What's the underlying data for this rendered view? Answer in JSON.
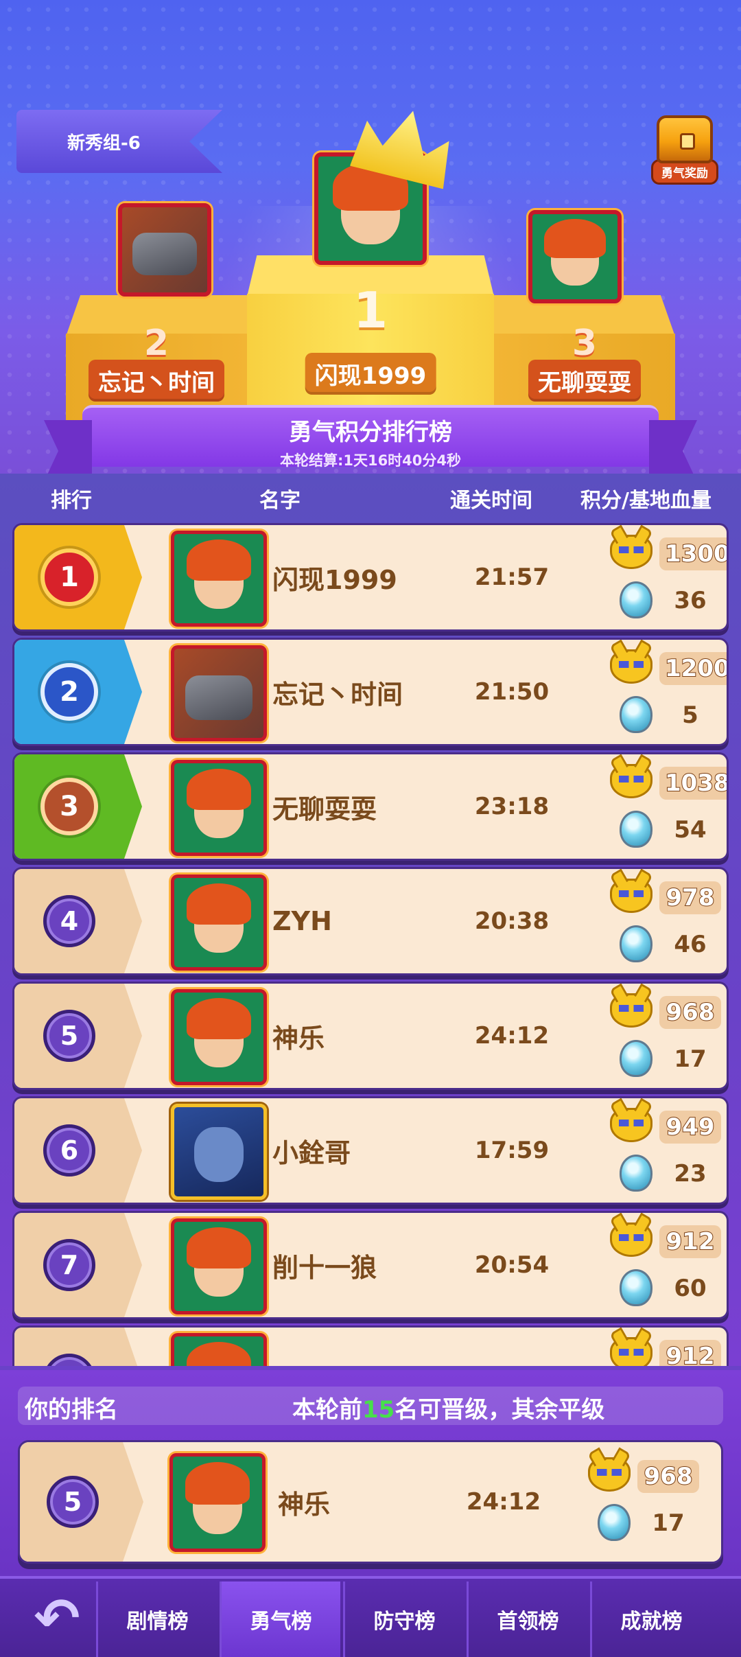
{
  "header": {
    "group_label": "新秀组-6",
    "reward_label": "勇气奖励",
    "banner_title": "勇气积分排行榜",
    "banner_sub": "本轮结算:1天16时40分4秒"
  },
  "podium": [
    {
      "place": "1",
      "name": "闪现1999",
      "avatar": "elf"
    },
    {
      "place": "2",
      "name": "忘记丶时间",
      "avatar": "knight"
    },
    {
      "place": "3",
      "name": "无聊耍耍",
      "avatar": "elf"
    }
  ],
  "columns": {
    "rank": "排行",
    "name": "名字",
    "time": "通关时间",
    "score": "积分/基地血量"
  },
  "rows": [
    {
      "rank": "1",
      "name": "闪现1999",
      "time": "21:57",
      "score": "1300",
      "hp": "36",
      "avatar": "elf"
    },
    {
      "rank": "2",
      "name": "忘记丶时间",
      "time": "21:50",
      "score": "1200",
      "hp": "5",
      "avatar": "knight"
    },
    {
      "rank": "3",
      "name": "无聊耍耍",
      "time": "23:18",
      "score": "1038",
      "hp": "54",
      "avatar": "elf"
    },
    {
      "rank": "4",
      "name": "ZYH",
      "time": "20:38",
      "score": "978",
      "hp": "46",
      "avatar": "elf"
    },
    {
      "rank": "5",
      "name": "神乐",
      "time": "24:12",
      "score": "968",
      "hp": "17",
      "avatar": "elf"
    },
    {
      "rank": "6",
      "name": "小銓哥",
      "time": "17:59",
      "score": "949",
      "hp": "23",
      "avatar": "cat"
    },
    {
      "rank": "7",
      "name": "削十一狼",
      "time": "20:54",
      "score": "912",
      "hp": "60",
      "avatar": "elf"
    },
    {
      "rank": "",
      "name": "",
      "time": "",
      "score": "912",
      "hp": "",
      "avatar": "elf"
    }
  ],
  "my_rank": {
    "label": "你的排名",
    "note_prefix": "本轮前",
    "note_count": "15",
    "note_suffix": "名可晋级，其余平级",
    "rank": "5",
    "name": "神乐",
    "time": "24:12",
    "score": "968",
    "hp": "17"
  },
  "nav": {
    "back_icon": "↶",
    "tabs": [
      "剧情榜",
      "勇气榜",
      "防守榜",
      "首领榜",
      "成就榜"
    ],
    "active_tab": "勇气榜"
  },
  "colors": {
    "rank1": "#f3b81c",
    "rank2": "#35a6e4",
    "rank3": "#5fba23",
    "row_bg": "#fbe9d4",
    "highlight": "#47e04a"
  }
}
